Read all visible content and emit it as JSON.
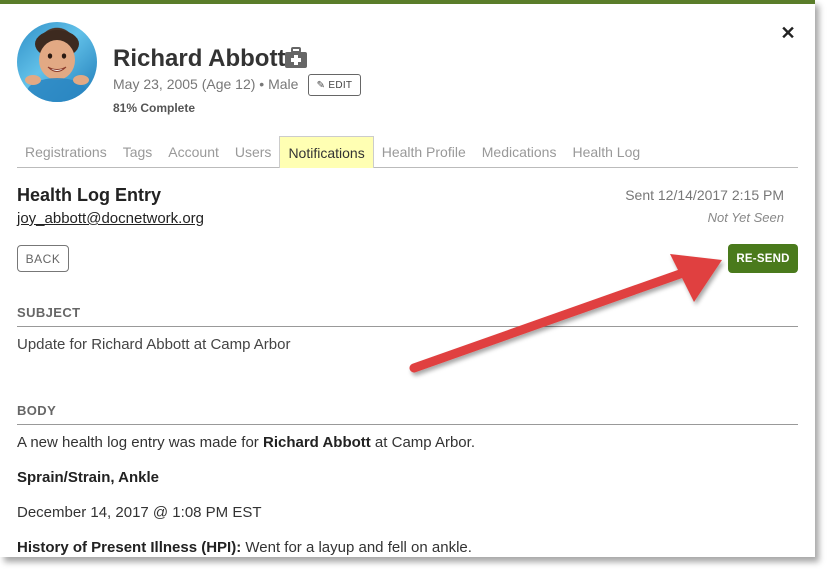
{
  "header": {
    "name": "Richard Abbott",
    "meta": "May 23, 2005 (Age 12) • Male",
    "edit_label": "EDIT",
    "complete": "81% Complete",
    "close_label": "✕"
  },
  "tabs": [
    {
      "label": "Registrations"
    },
    {
      "label": "Tags"
    },
    {
      "label": "Account"
    },
    {
      "label": "Users"
    },
    {
      "label": "Notifications",
      "active": true
    },
    {
      "label": "Health Profile"
    },
    {
      "label": "Medications"
    },
    {
      "label": "Health Log"
    }
  ],
  "entry": {
    "title": "Health Log Entry",
    "email": "joy_abbott@docnetwork.org",
    "sent": "Sent 12/14/2017 2:15 PM",
    "seen": "Not Yet Seen",
    "back_label": "BACK",
    "resend_label": "RE-SEND"
  },
  "subject": {
    "heading": "SUBJECT",
    "text": "Update for Richard Abbott at Camp Arbor"
  },
  "body": {
    "heading": "BODY",
    "line1_prefix": "A new health log entry was made for ",
    "line1_name": "Richard Abbott",
    "line1_suffix": " at Camp Arbor.",
    "line2": "Sprain/Strain, Ankle",
    "line3": "December 14, 2017 @ 1:08 PM EST",
    "line4_label": "History of Present Illness (HPI):",
    "line4_text": " Went for a layup and fell on ankle."
  },
  "colors": {
    "accent_green": "#4a7a1c",
    "top_border": "#5a7d2a",
    "active_tab_bg": "#ffffb3",
    "arrow": "#e0403f"
  },
  "icons": {
    "close": "close-icon",
    "medical": "medical-kit-icon",
    "edit": "pencil-icon"
  }
}
